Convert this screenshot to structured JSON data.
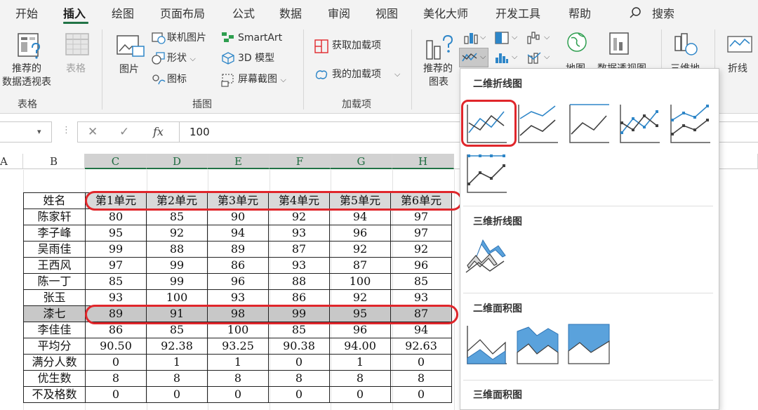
{
  "menu": {
    "tabs": [
      {
        "label": "开始"
      },
      {
        "label": "插入"
      },
      {
        "label": "绘图"
      },
      {
        "label": "页面布局"
      },
      {
        "label": "公式"
      },
      {
        "label": "数据"
      },
      {
        "label": "审阅"
      },
      {
        "label": "视图"
      },
      {
        "label": "美化大师"
      },
      {
        "label": "开发工具"
      },
      {
        "label": "帮助"
      }
    ],
    "search": "搜索"
  },
  "ribbon": {
    "tables": {
      "pivot_line1": "推荐的",
      "pivot_line2": "数据透视表",
      "table": "表格",
      "group": "表格"
    },
    "illustrations": {
      "pictures": "图片",
      "online_pictures": "联机图片",
      "shapes": "形状",
      "icons": "图标",
      "smartart": "SmartArt",
      "model3d": "3D 模型",
      "screenshot": "屏幕截图",
      "group": "插图"
    },
    "addins": {
      "get": "获取加载项",
      "my": "我的加载项",
      "group": "加载项"
    },
    "charts": {
      "recommended_line1": "推荐的",
      "recommended_line2": "图表",
      "map": "地图",
      "pivot_chart": "数据透视图",
      "three_d_map": "三维地",
      "line": "折线"
    }
  },
  "formula_bar": {
    "fx": "fx",
    "value": "100"
  },
  "columns": [
    "A",
    "B",
    "C",
    "D",
    "E",
    "F",
    "G",
    "H"
  ],
  "table": {
    "header": [
      "姓名",
      "第1单元",
      "第2单元",
      "第3单元",
      "第4单元",
      "第5单元",
      "第6单元"
    ],
    "rows": [
      [
        "陈家轩",
        "80",
        "85",
        "90",
        "92",
        "94",
        "97"
      ],
      [
        "李子峰",
        "95",
        "92",
        "94",
        "93",
        "96",
        "97"
      ],
      [
        "吴雨佳",
        "99",
        "88",
        "89",
        "87",
        "92",
        "92"
      ],
      [
        "王西风",
        "97",
        "99",
        "86",
        "93",
        "87",
        "96"
      ],
      [
        "陈一丁",
        "85",
        "99",
        "96",
        "88",
        "100",
        "85"
      ],
      [
        "张玉",
        "93",
        "100",
        "93",
        "86",
        "92",
        "93"
      ],
      [
        "漆七",
        "89",
        "91",
        "98",
        "99",
        "95",
        "87"
      ],
      [
        "李佳佳",
        "86",
        "85",
        "100",
        "85",
        "96",
        "94"
      ],
      [
        "平均分",
        "90.50",
        "92.38",
        "93.25",
        "90.38",
        "94.00",
        "92.63"
      ],
      [
        "满分人数",
        "0",
        "1",
        "1",
        "0",
        "1",
        "0"
      ],
      [
        "优生数",
        "8",
        "8",
        "8",
        "8",
        "8",
        "8"
      ],
      [
        "不及格数",
        "0",
        "0",
        "0",
        "0",
        "0",
        "0"
      ]
    ]
  },
  "chart_menu": {
    "sections": [
      "二维折线图",
      "三维折线图",
      "二维面积图",
      "三维面积图"
    ]
  },
  "colors": {
    "accent_green": "#217346",
    "highlight_red": "#e0262b",
    "chart_blue": "#2e86c8",
    "chart_dark": "#404040"
  }
}
